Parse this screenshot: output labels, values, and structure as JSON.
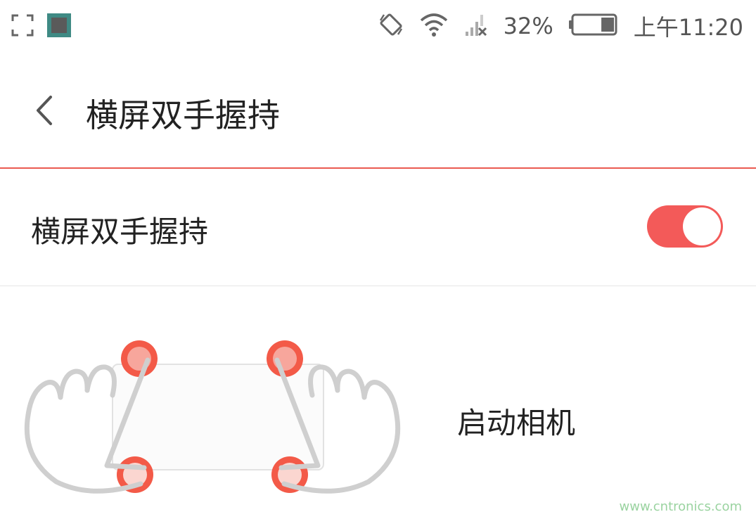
{
  "status_bar": {
    "battery_percent": "32%",
    "time": "上午11:20",
    "icons": [
      "screenshot-frame-icon",
      "app-notification-icon",
      "auto-rotate-icon",
      "wifi-icon",
      "signal-no-sim-icon",
      "battery-icon"
    ],
    "battery_level": 0.32
  },
  "header": {
    "title": "横屏双手握持"
  },
  "setting": {
    "label": "横屏双手握持",
    "enabled": true
  },
  "gesture": {
    "label": "启动相机"
  },
  "watermark": "www.cntronics.com",
  "colors": {
    "accent": "#f35a59",
    "line": "#ea5a50",
    "touch_point": "#f35a48",
    "hand_outline": "#cfcfcf"
  }
}
